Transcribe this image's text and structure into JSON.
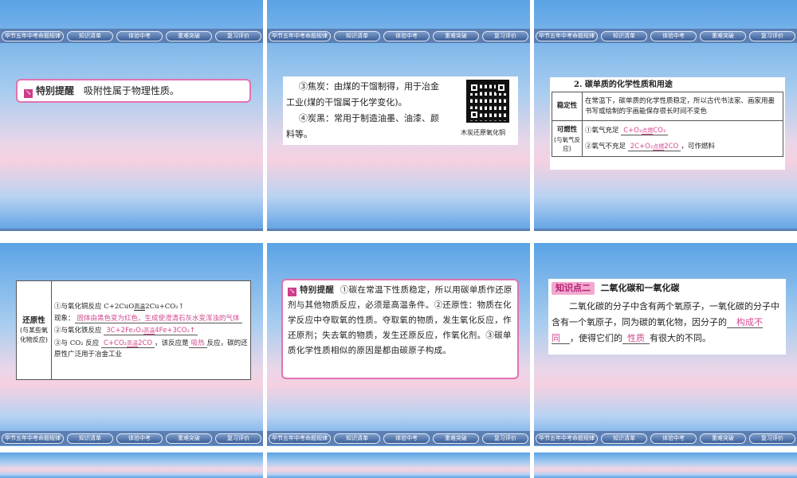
{
  "nav_items": [
    "毕节五年中考命题规律",
    "知识清单",
    "体验中考",
    "重难突破",
    "复习评价"
  ],
  "slide1": {
    "tip_label": "特别提醒",
    "tip_text": "吸附性属于物理性质。"
  },
  "slide2": {
    "line1": "③焦炭：由煤的干馏制得，用于冶金",
    "line2": "工业(煤的干馏属于化学变化)。",
    "line3": "④炭黑：常用于制造油墨、油漆、颜",
    "line4": "料等。",
    "qr_caption": "木炭还原氧化铜"
  },
  "slide3": {
    "heading": "2. 碳单质的化学性质和用途",
    "row1_label": "稳定性",
    "row1_text": "在常温下，碳单质的化学性质稳定，所以古代书法家、画家用墨书写或绘制的字画能保存很长时间不变色",
    "row2_label": "可燃性",
    "row2_sub": "(与氧气反应)",
    "full_prefix": "①氧气充足",
    "full_left": "C+O₂",
    "full_cond": "点燃",
    "full_right": "CO₂",
    "lack_prefix": "②氧气不充足",
    "lack_left": "2C+O₂",
    "lack_cond": "点燃",
    "lack_right": "2CO",
    "lack_suffix": "，可作燃料"
  },
  "slide4": {
    "label": "还原性",
    "sub": "(与某些氧化物反应)",
    "r1_prefix": "①与氧化铜反应 C+2CuO",
    "r1_cond": "高温",
    "r1_right": "2Cu+CO₂↑",
    "phen_label": "现象：",
    "phen_text": "固体由黑色变为红色，生成使澄清石灰水变浑浊的气体",
    "r2_prefix": "②与氧化铁反应",
    "r2_left": "3C+2Fe₂O₃",
    "r2_cond": "高温",
    "r2_right": "4Fe+3CO₂↑",
    "r3_prefix": "③与 CO₂ 反应",
    "r3_left": "C+CO₂",
    "r3_cond": "高温",
    "r3_right": "2CO",
    "r3_mid": "，该反应是",
    "r3_ans": "吸热",
    "r3_suffix": "反应，碳的还原性广泛用于冶金工业"
  },
  "slide5": {
    "tip_label": "特别提醒",
    "text": "①碳在常温下性质稳定，所以用碳单质作还原剂与其他物质反应，必须是高温条件。②还原性：物质在化学反应中夺取氧的性质。夺取氧的物质，发生氧化反应，作还原剂；失去氧的物质，发生还原反应，作氧化剂。③碳单质化学性质相似的原因是都由碳原子构成。"
  },
  "slide6": {
    "tag": "知识点二",
    "title": "二氧化碳和一氧化碳",
    "p1": "二氧化碳的分子中含有两个氧原子，一氧化碳的分子中含有一个氧原子，同为碳的氧化物，因分子的",
    "ans1": "构成不同",
    "p2": "，使得它们的",
    "ans2": "性质",
    "p3": "有很大的不同。"
  }
}
